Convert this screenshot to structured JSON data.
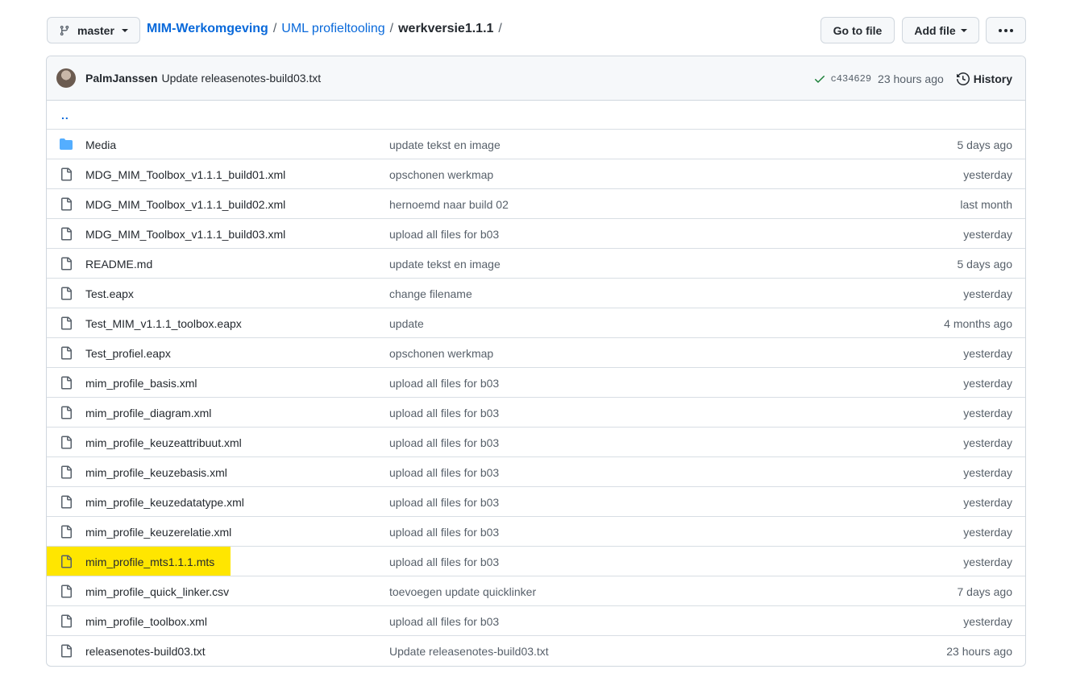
{
  "branch": {
    "name": "master",
    "icon": "git-branch-icon"
  },
  "breadcrumb": {
    "repo": "MIM-Werkomgeving",
    "folder": "UML profieltooling",
    "current": "werkversie1.1.1",
    "separator": "/"
  },
  "actions": {
    "go_to_file": "Go to file",
    "add_file": "Add file",
    "more": "more-icon"
  },
  "commit": {
    "author": "PalmJanssen",
    "message": "Update releasenotes-build03.txt",
    "sha": "c434629",
    "time": "23 hours ago",
    "history_label": "History",
    "status_color": "#1a7f37"
  },
  "updir": "..",
  "colors": {
    "link": "#0969da",
    "highlight": "#ffe600",
    "folder": "#54aeff"
  },
  "files": [
    {
      "name": "Media",
      "message": "update tekst en image",
      "age": "5 days ago",
      "type": "folder"
    },
    {
      "name": "MDG_MIM_Toolbox_v1.1.1_build01.xml",
      "message": "opschonen werkmap",
      "age": "yesterday",
      "type": "file"
    },
    {
      "name": "MDG_MIM_Toolbox_v1.1.1_build02.xml",
      "message": "hernoemd naar build 02",
      "age": "last month",
      "type": "file"
    },
    {
      "name": "MDG_MIM_Toolbox_v1.1.1_build03.xml",
      "message": "upload all files for b03",
      "age": "yesterday",
      "type": "file"
    },
    {
      "name": "README.md",
      "message": "update tekst en image",
      "age": "5 days ago",
      "type": "file"
    },
    {
      "name": "Test.eapx",
      "message": "change filename",
      "age": "yesterday",
      "type": "file"
    },
    {
      "name": "Test_MIM_v1.1.1_toolbox.eapx",
      "message": "update",
      "age": "4 months ago",
      "type": "file"
    },
    {
      "name": "Test_profiel.eapx",
      "message": "opschonen werkmap",
      "age": "yesterday",
      "type": "file"
    },
    {
      "name": "mim_profile_basis.xml",
      "message": "upload all files for b03",
      "age": "yesterday",
      "type": "file"
    },
    {
      "name": "mim_profile_diagram.xml",
      "message": "upload all files for b03",
      "age": "yesterday",
      "type": "file"
    },
    {
      "name": "mim_profile_keuzeattribuut.xml",
      "message": "upload all files for b03",
      "age": "yesterday",
      "type": "file"
    },
    {
      "name": "mim_profile_keuzebasis.xml",
      "message": "upload all files for b03",
      "age": "yesterday",
      "type": "file"
    },
    {
      "name": "mim_profile_keuzedatatype.xml",
      "message": "upload all files for b03",
      "age": "yesterday",
      "type": "file"
    },
    {
      "name": "mim_profile_keuzerelatie.xml",
      "message": "upload all files for b03",
      "age": "yesterday",
      "type": "file"
    },
    {
      "name": "mim_profile_mts1.1.1.mts",
      "message": "upload all files for b03",
      "age": "yesterday",
      "type": "file",
      "highlighted": true
    },
    {
      "name": "mim_profile_quick_linker.csv",
      "message": "toevoegen update quicklinker",
      "age": "7 days ago",
      "type": "file"
    },
    {
      "name": "mim_profile_toolbox.xml",
      "message": "upload all files for b03",
      "age": "yesterday",
      "type": "file"
    },
    {
      "name": "releasenotes-build03.txt",
      "message": "Update releasenotes-build03.txt",
      "age": "23 hours ago",
      "type": "file"
    }
  ]
}
